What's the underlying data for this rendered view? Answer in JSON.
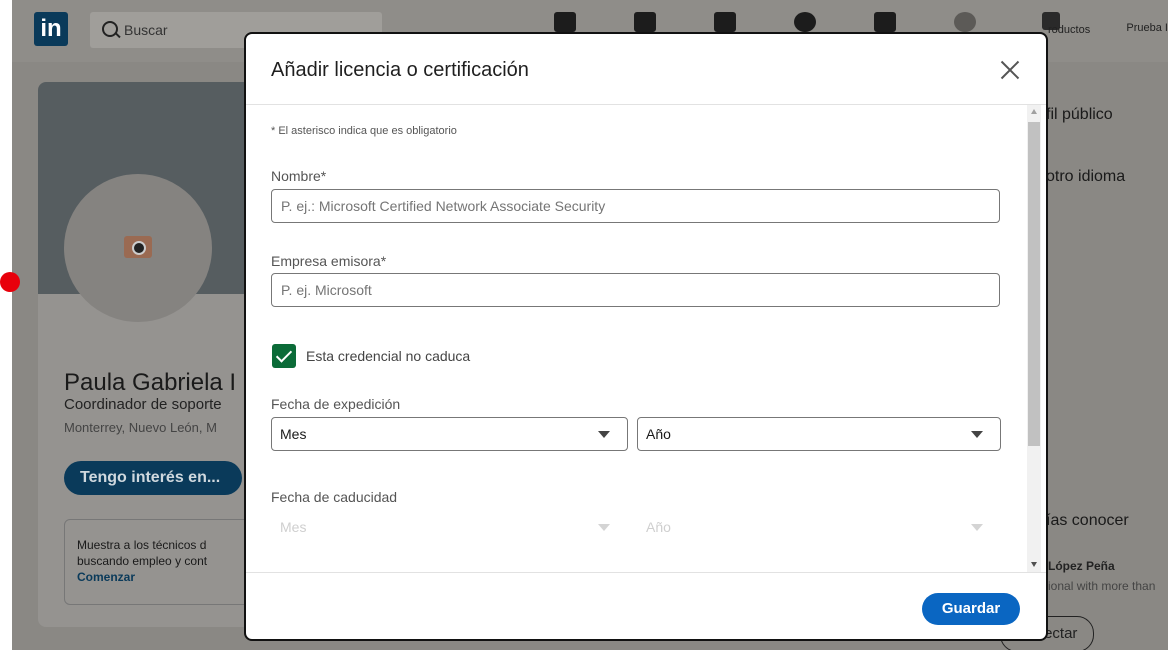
{
  "nav": {
    "search_placeholder": "Buscar",
    "products_label": "roductos",
    "user_label": "Prueba I"
  },
  "profile": {
    "name": "Paula Gabriela I",
    "title": "Coordinador de soporte",
    "location": "Monterrey, Nuevo León, M",
    "interest_button": "Tengo interés en...",
    "promo_line1": "Muestra a los técnicos d",
    "promo_line2": "buscando empleo y cont",
    "promo_link": "Comenzar"
  },
  "right_panel": {
    "public_profile": "fil público",
    "other_language": "otro idioma",
    "people_heading": "ías conocer",
    "person_name": "López Peña",
    "person_desc": "ional with more than",
    "connect_button": "Conectar"
  },
  "modal": {
    "title": "Añadir licencia o certificación",
    "required_note": "* El asterisco indica que es obligatorio",
    "name_label": "Nombre*",
    "name_placeholder": "P. ej.: Microsoft Certified Network Associate Security",
    "issuer_label": "Empresa emisora*",
    "issuer_placeholder": "P. ej. Microsoft",
    "no_expire_label": "Esta credencial no caduca",
    "no_expire_checked": true,
    "issue_date_label": "Fecha de expedición",
    "issue_month": "Mes",
    "issue_year": "Año",
    "expiry_date_label": "Fecha de caducidad",
    "expiry_month": "Mes",
    "expiry_year": "Año",
    "save_button": "Guardar"
  },
  "colors": {
    "primary": "#0a66c2",
    "checkbox": "#0b6b38",
    "overlay": "#8a8884"
  }
}
